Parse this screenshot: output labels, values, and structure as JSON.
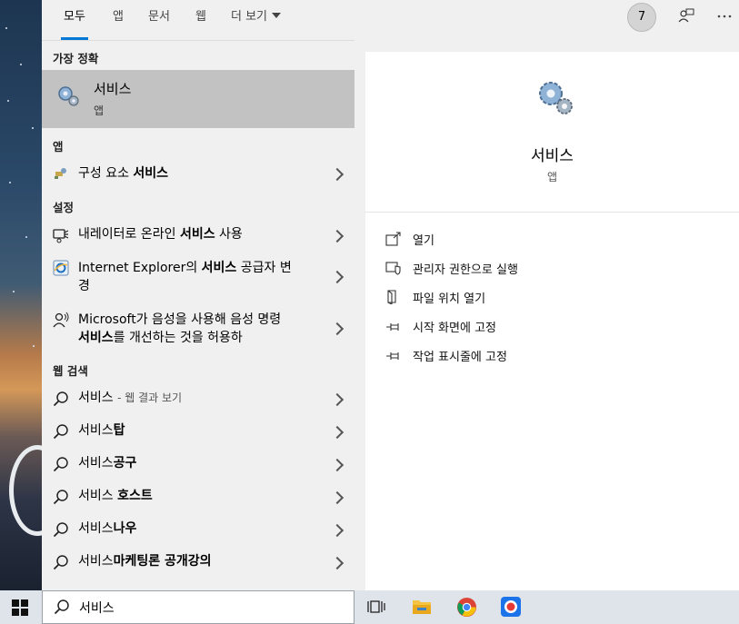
{
  "filters": {
    "tabs": [
      "모두",
      "앱",
      "문서",
      "웹"
    ],
    "more_label": "더 보기"
  },
  "topbar": {
    "badge": "7"
  },
  "best_match": {
    "heading": "가장 정확",
    "title": "서비스",
    "subtitle": "앱"
  },
  "apps_section": {
    "heading": "앱",
    "item": {
      "pre": "구성 요소 ",
      "bold": "서비스",
      "post": ""
    }
  },
  "settings_section": {
    "heading": "설정",
    "items": [
      {
        "pre": "내레이터로 온라인 ",
        "bold": "서비스",
        "post": " 사용"
      },
      {
        "pre": "Internet Explorer의 ",
        "bold": "서비스",
        "post": " 공급자 변경"
      },
      {
        "pre": "Microsoft가 음성을 사용해 음성 명령 ",
        "bold": "서비스",
        "post": "를 개선하는 것을 허용하"
      }
    ]
  },
  "web_section": {
    "heading": "웹 검색",
    "first": {
      "term": "서비스",
      "suffix": "- 웹 결과 보기"
    },
    "items": [
      {
        "pre": "서비스",
        "bold": "탑"
      },
      {
        "pre": "서비스",
        "bold": "공구"
      },
      {
        "pre": "서비스 ",
        "bold": "호스트"
      },
      {
        "pre": "서비스",
        "bold": "나우"
      },
      {
        "pre": "서비스",
        "bold": "마케팅론 공개강의"
      }
    ]
  },
  "preview": {
    "title": "서비스",
    "subtitle": "앱",
    "actions": [
      "열기",
      "관리자 권한으로 실행",
      "파일 위치 열기",
      "시작 화면에 고정",
      "작업 표시줄에 고정"
    ]
  },
  "taskbar": {
    "search_value": "서비스"
  },
  "colors": {
    "accent": "#0078d7",
    "highlight": "#c2c2c2",
    "pane": "#f0f0f0"
  },
  "icons": [
    "gear-icon",
    "component-icon",
    "narrator-icon",
    "ie-icon",
    "speech-icon",
    "search-icon",
    "open-icon",
    "admin-shield-icon",
    "folder-icon",
    "pin-icon",
    "windows-icon",
    "task-view-icon",
    "file-explorer-icon",
    "chrome-icon",
    "record-icon",
    "feedback-icon",
    "more-icon"
  ]
}
